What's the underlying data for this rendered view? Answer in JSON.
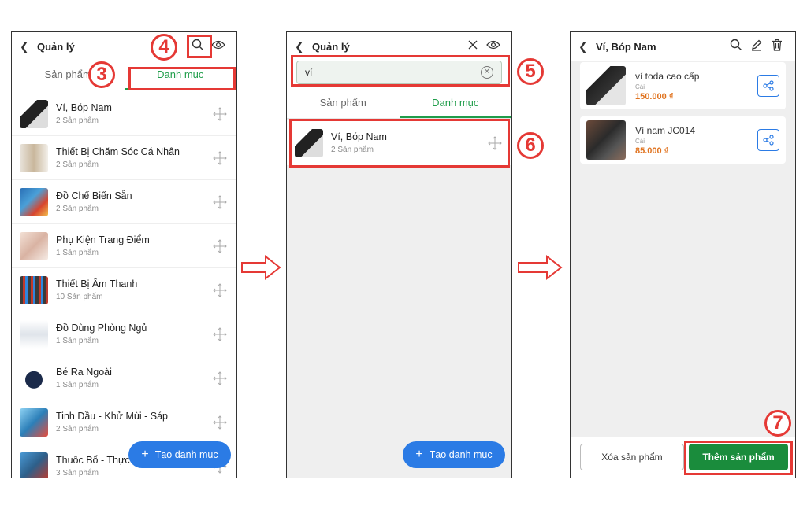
{
  "screen1": {
    "header": {
      "title": "Quản lý"
    },
    "tabs": [
      "Sản phẩm",
      "Danh mục"
    ],
    "categories": [
      {
        "name": "Ví, Bóp Nam",
        "count": "2 Sản phẩm"
      },
      {
        "name": "Thiết Bị Chăm Sóc Cá Nhân",
        "count": "2 Sản phẩm"
      },
      {
        "name": "Đồ Chế Biến Sẵn",
        "count": "2 Sản phẩm"
      },
      {
        "name": "Phụ Kiện Trang Điểm",
        "count": "1 Sản phẩm"
      },
      {
        "name": "Thiết Bị Âm Thanh",
        "count": "10 Sản phẩm"
      },
      {
        "name": "Đồ Dùng Phòng Ngủ",
        "count": "1 Sản phẩm"
      },
      {
        "name": "Bé Ra Ngoài",
        "count": "1 Sản phẩm"
      },
      {
        "name": "Tinh Dầu - Khử Mùi - Sáp",
        "count": "2 Sản phẩm"
      },
      {
        "name": "Thuốc Bổ - Thực Phẩm",
        "count": "3 Sản phẩm"
      }
    ],
    "fab_label": "Tạo danh mục"
  },
  "screen2": {
    "header": {
      "title": "Quản lý"
    },
    "search": {
      "value": "ví"
    },
    "tabs": [
      "Sản phẩm",
      "Danh mục"
    ],
    "result": {
      "name": "Ví, Bóp Nam",
      "count": "2 Sản phẩm"
    },
    "fab_label": "Tạo danh mục"
  },
  "screen3": {
    "header": {
      "title": "Ví, Bóp Nam"
    },
    "products": [
      {
        "name": "ví toda cao cấp",
        "unit": "Cái",
        "price": "150.000 ₫"
      },
      {
        "name": "Ví nam JC014",
        "unit": "Cái",
        "price": "85.000 ₫"
      }
    ],
    "delete_label": "Xóa sản phẩm",
    "add_label": "Thêm sản phẩm"
  },
  "steps": [
    "3",
    "4",
    "5",
    "6",
    "7"
  ],
  "colors": {
    "accent_green": "#1f9d4a",
    "fab_blue": "#2b7be5",
    "highlight_red": "#e53935",
    "price_orange": "#e0731f"
  }
}
